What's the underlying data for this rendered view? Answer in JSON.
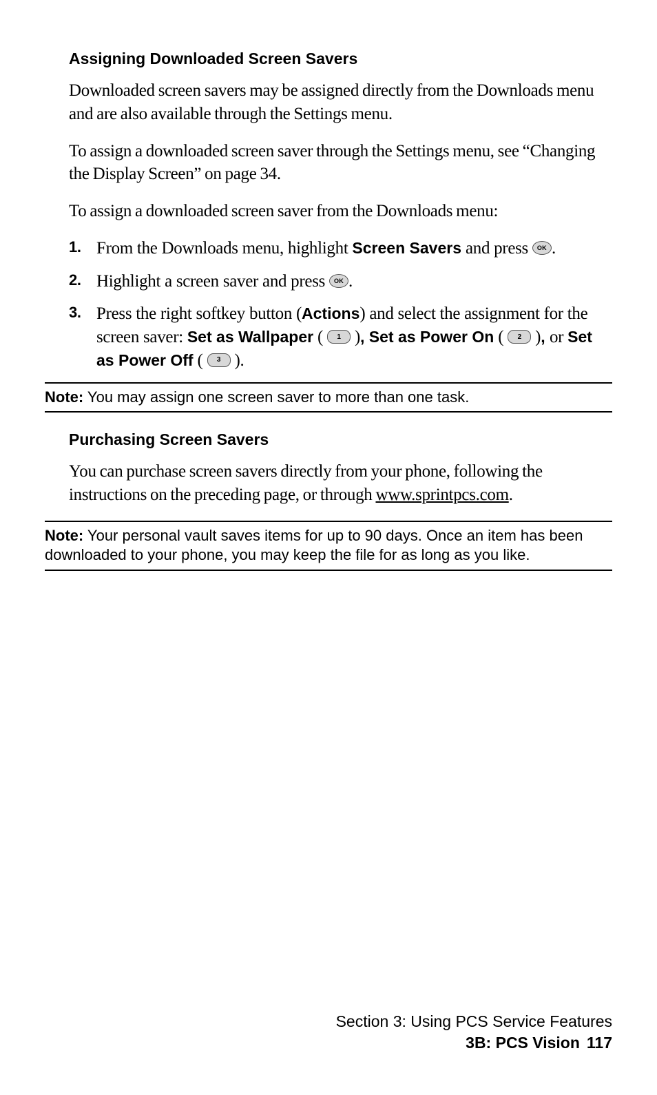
{
  "section1": {
    "heading": "Assigning Downloaded Screen Savers",
    "p1": "Downloaded screen savers may be assigned directly from the Downloads menu and are also available through the Settings menu.",
    "p2a": "To assign a downloaded screen saver through the Settings menu, see “Changing the Display Screen” on page 34.",
    "p3": "To assign a downloaded screen saver from the Downloads menu:",
    "steps": {
      "s1_num": "1.",
      "s1_a": "From the Downloads menu, highlight ",
      "s1_b": "Screen Savers",
      "s1_c": " and press ",
      "s1_d": ".",
      "s2_num": "2.",
      "s2_a": "Highlight a screen saver and press ",
      "s2_b": ".",
      "s3_num": "3.",
      "s3_a": "Press the right softkey button (",
      "s3_b": "Actions",
      "s3_c": ") and select the assignment for the screen saver: ",
      "s3_d": "Set as Wallpaper",
      "s3_e": " ( ",
      "s3_f": " )",
      "s3_g": ", ",
      "s3_h": "Set as Power On",
      "s3_i": " ( ",
      "s3_j": " )",
      "s3_k": ", ",
      "s3_l": "or ",
      "s3_m": "Set as Power Off",
      "s3_n": " ( ",
      "s3_o": " )",
      "s3_p": "."
    },
    "key_ok": "OK",
    "key1": "1",
    "key2": "2",
    "key3": "3"
  },
  "note1": {
    "label": "Note:",
    "text": " You may assign one screen saver to more than one task."
  },
  "section2": {
    "heading": "Purchasing Screen Savers",
    "p1a": "You can purchase screen savers directly from your phone, following the instructions on the preceding page, or through ",
    "p1b": "www.sprintpcs.com",
    "p1c": "."
  },
  "note2": {
    "label": "Note:",
    "text": " Your personal vault saves items for up to 90 days. Once an item has been downloaded to your phone, you may keep the file for as long as you like."
  },
  "footer": {
    "line1": "Section 3: Using PCS Service Features",
    "line2": "3B: PCS Vision",
    "page": "117"
  }
}
